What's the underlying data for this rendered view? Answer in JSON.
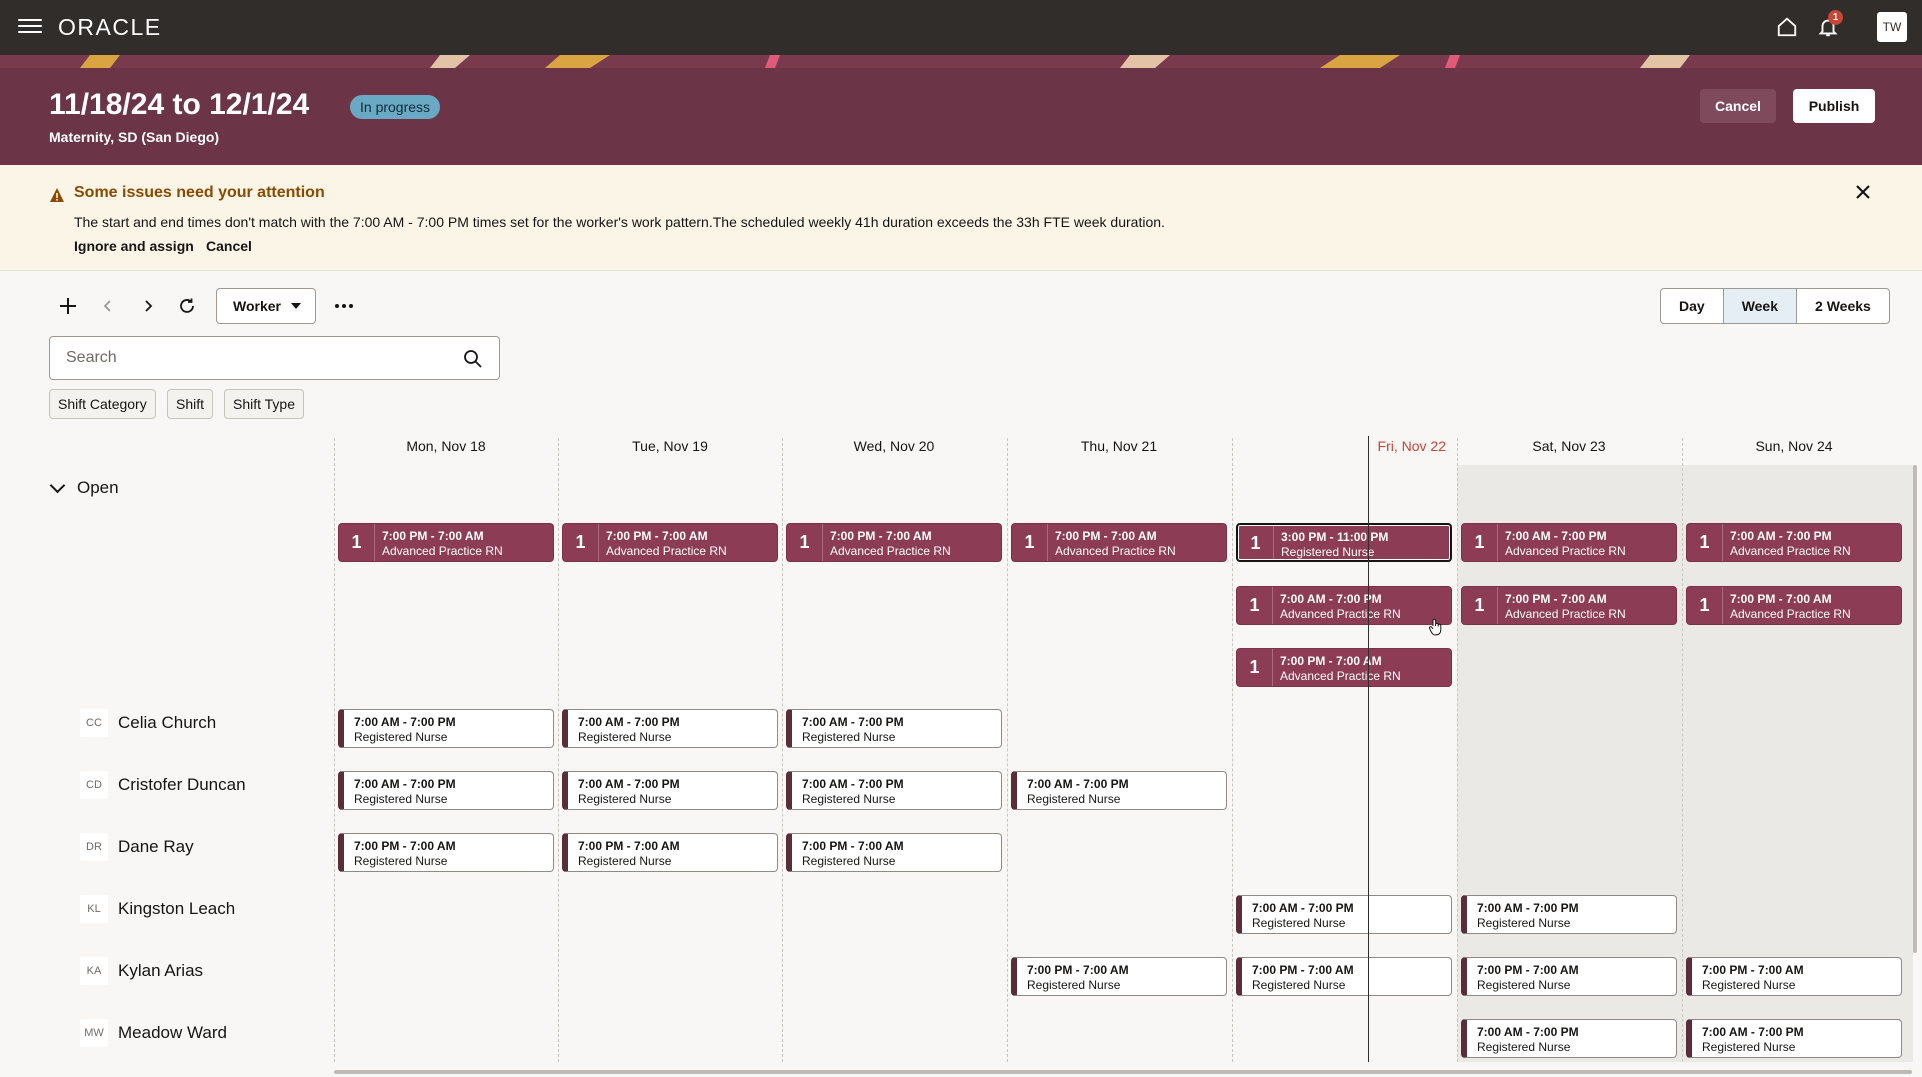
{
  "nav": {
    "brand": "ORACLE",
    "notification_count": "1",
    "user_initials": "TW"
  },
  "header": {
    "title": "11/18/24 to 12/1/24",
    "status": "In progress",
    "subtitle": "Maternity, SD (San Diego)",
    "cancel_label": "Cancel",
    "publish_label": "Publish"
  },
  "alert": {
    "title": "Some issues need your attention",
    "message": "The start and end times don't match with the 7:00 AM - 7:00 PM times set for the worker's work pattern.The scheduled weekly 41h duration exceeds the 33h FTE week duration.",
    "ignore_label": "Ignore and assign",
    "cancel_label": "Cancel"
  },
  "toolbar": {
    "worker_label": "Worker",
    "views": [
      "Day",
      "Week",
      "2 Weeks"
    ],
    "active_view": "Week"
  },
  "search": {
    "placeholder": "Search"
  },
  "filters": [
    "Shift Category",
    "Shift",
    "Shift Type"
  ],
  "days": [
    "Mon, Nov 18",
    "Tue, Nov 19",
    "Wed, Nov 20",
    "Thu, Nov 21",
    "Fri, Nov 22",
    "Sat, Nov 23",
    "Sun, Nov 24"
  ],
  "today": "Fri, Nov 22",
  "group": {
    "label": "Open"
  },
  "open_shifts": [
    {
      "day": 0,
      "slot": 0,
      "count": "1",
      "time": "7:00 PM - 7:00 AM",
      "role": "Advanced Practice RN"
    },
    {
      "day": 1,
      "slot": 0,
      "count": "1",
      "time": "7:00 PM - 7:00 AM",
      "role": "Advanced Practice RN"
    },
    {
      "day": 2,
      "slot": 0,
      "count": "1",
      "time": "7:00 PM - 7:00 AM",
      "role": "Advanced Practice RN"
    },
    {
      "day": 3,
      "slot": 0,
      "count": "1",
      "time": "7:00 PM - 7:00 AM",
      "role": "Advanced Practice RN"
    },
    {
      "day": 4,
      "slot": 0,
      "count": "1",
      "time": "3:00 PM - 11:00 PM",
      "role": "Registered Nurse",
      "selected": true
    },
    {
      "day": 5,
      "slot": 0,
      "count": "1",
      "time": "7:00 AM - 7:00 PM",
      "role": "Advanced Practice RN"
    },
    {
      "day": 6,
      "slot": 0,
      "count": "1",
      "time": "7:00 AM - 7:00 PM",
      "role": "Advanced Practice RN"
    },
    {
      "day": 4,
      "slot": 1,
      "count": "1",
      "time": "7:00 AM - 7:00 PM",
      "role": "Advanced Practice RN"
    },
    {
      "day": 5,
      "slot": 1,
      "count": "1",
      "time": "7:00 PM - 7:00 AM",
      "role": "Advanced Practice RN"
    },
    {
      "day": 6,
      "slot": 1,
      "count": "1",
      "time": "7:00 PM - 7:00 AM",
      "role": "Advanced Practice RN"
    },
    {
      "day": 4,
      "slot": 2,
      "count": "1",
      "time": "7:00 PM - 7:00 AM",
      "role": "Advanced Practice RN"
    }
  ],
  "workers": [
    {
      "initials": "CC",
      "name": "Celia Church",
      "shifts": [
        {
          "day": 0,
          "time": "7:00 AM - 7:00 PM",
          "role": "Registered Nurse"
        },
        {
          "day": 1,
          "time": "7:00 AM - 7:00 PM",
          "role": "Registered Nurse"
        },
        {
          "day": 2,
          "time": "7:00 AM - 7:00 PM",
          "role": "Registered Nurse"
        }
      ]
    },
    {
      "initials": "CD",
      "name": "Cristofer Duncan",
      "shifts": [
        {
          "day": 0,
          "time": "7:00 AM - 7:00 PM",
          "role": "Registered Nurse"
        },
        {
          "day": 1,
          "time": "7:00 AM - 7:00 PM",
          "role": "Registered Nurse"
        },
        {
          "day": 2,
          "time": "7:00 AM - 7:00 PM",
          "role": "Registered Nurse"
        },
        {
          "day": 3,
          "time": "7:00 AM - 7:00 PM",
          "role": "Registered Nurse"
        }
      ]
    },
    {
      "initials": "DR",
      "name": "Dane Ray",
      "shifts": [
        {
          "day": 0,
          "time": "7:00 PM - 7:00 AM",
          "role": "Registered Nurse"
        },
        {
          "day": 1,
          "time": "7:00 PM - 7:00 AM",
          "role": "Registered Nurse"
        },
        {
          "day": 2,
          "time": "7:00 PM - 7:00 AM",
          "role": "Registered Nurse"
        }
      ]
    },
    {
      "initials": "KL",
      "name": "Kingston Leach",
      "shifts": [
        {
          "day": 4,
          "time": "7:00 AM - 7:00 PM",
          "role": "Registered Nurse"
        },
        {
          "day": 5,
          "time": "7:00 AM - 7:00 PM",
          "role": "Registered Nurse"
        }
      ]
    },
    {
      "initials": "KA",
      "name": "Kylan Arias",
      "shifts": [
        {
          "day": 3,
          "time": "7:00 PM - 7:00 AM",
          "role": "Registered Nurse"
        },
        {
          "day": 4,
          "time": "7:00 PM - 7:00 AM",
          "role": "Registered Nurse"
        },
        {
          "day": 5,
          "time": "7:00 PM - 7:00 AM",
          "role": "Registered Nurse"
        },
        {
          "day": 6,
          "time": "7:00 PM - 7:00 AM",
          "role": "Registered Nurse"
        }
      ]
    },
    {
      "initials": "MW",
      "name": "Meadow Ward",
      "shifts": [
        {
          "day": 5,
          "time": "7:00 AM - 7:00 PM",
          "role": "Registered Nurse"
        },
        {
          "day": 6,
          "time": "7:00 AM - 7:00 PM",
          "role": "Registered Nurse"
        }
      ]
    }
  ],
  "colors": {
    "brand_header": "#6b3447",
    "open_shift": "#8d3c55",
    "today_text": "#c74634",
    "alert_bg": "#fbf5e7"
  }
}
